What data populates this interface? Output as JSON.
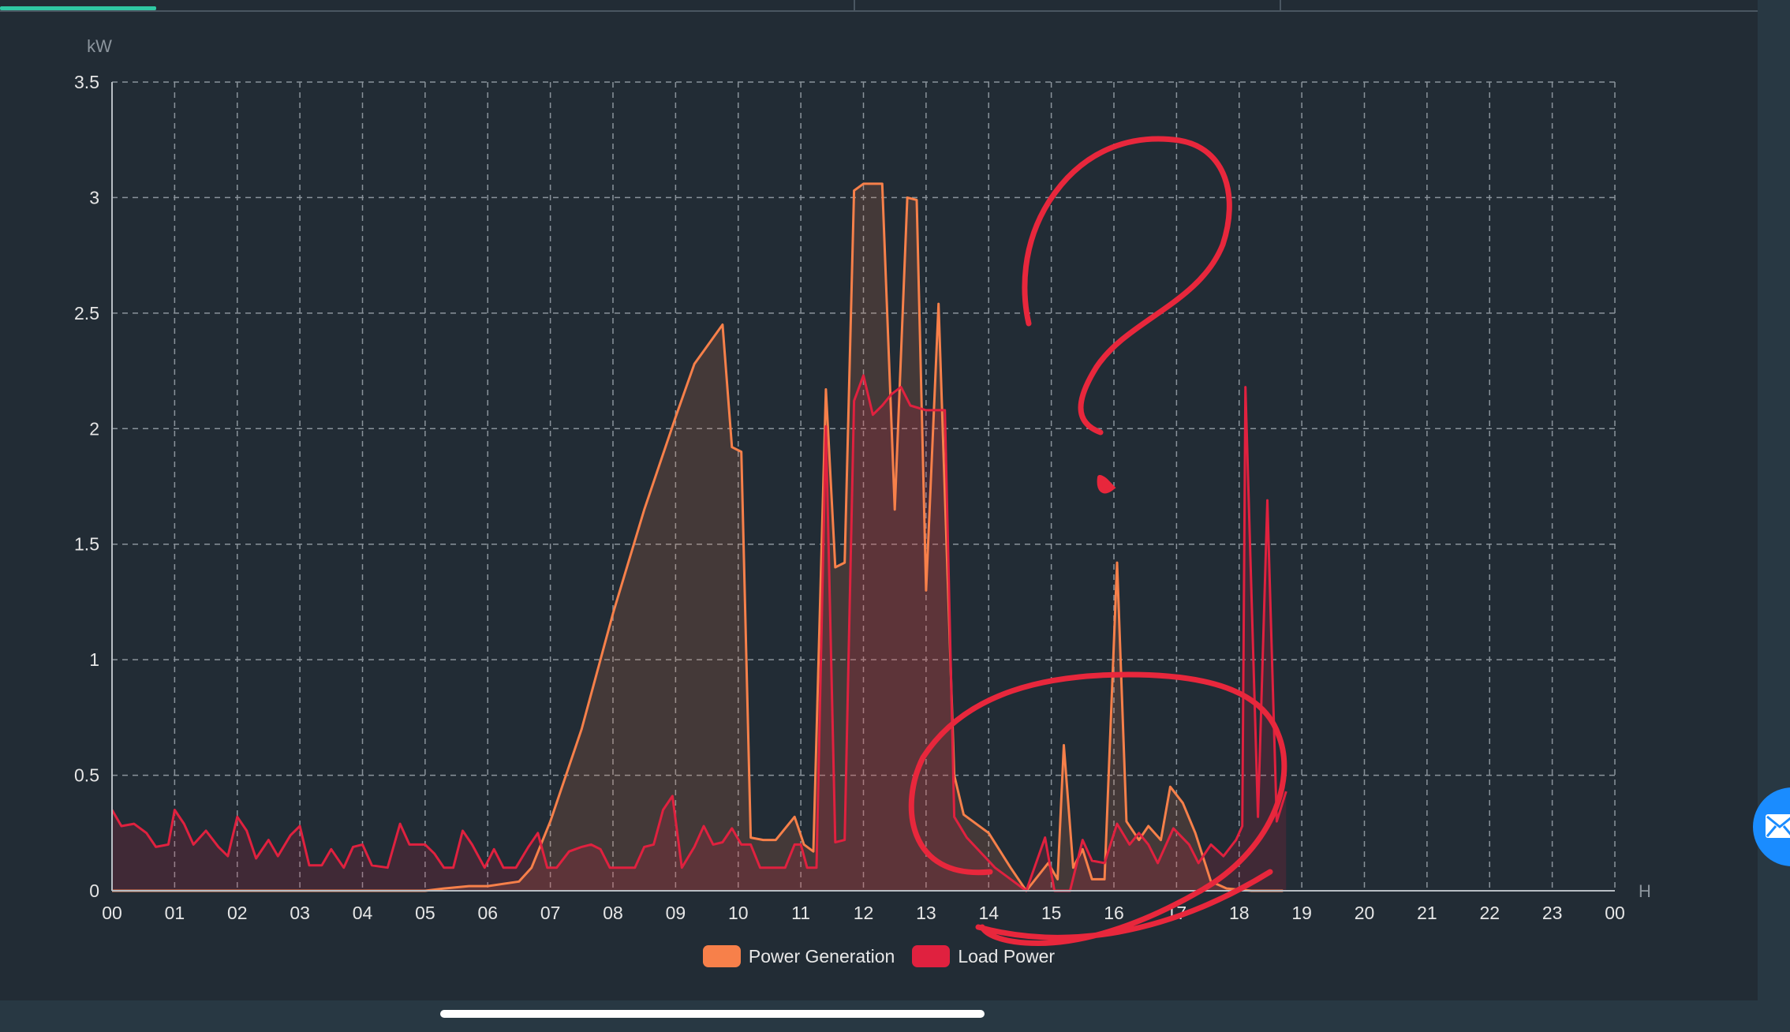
{
  "chart_data": {
    "type": "line",
    "unit_label": "kW",
    "x_unit_label": "H",
    "ylim": [
      0,
      3.5
    ],
    "y_ticks": [
      "0",
      "0.5",
      "1",
      "1.5",
      "2",
      "2.5",
      "3",
      "3.5"
    ],
    "x_ticks": [
      "00",
      "01",
      "02",
      "03",
      "04",
      "05",
      "06",
      "07",
      "08",
      "09",
      "10",
      "11",
      "12",
      "13",
      "14",
      "15",
      "16",
      "17",
      "18",
      "19",
      "20",
      "21",
      "22",
      "23",
      "00"
    ],
    "grid": true,
    "legend_position": "bottom-center",
    "series": [
      {
        "name": "Power Generation",
        "color": "#f7804a",
        "points": [
          [
            0,
            0
          ],
          [
            1,
            0
          ],
          [
            2,
            0
          ],
          [
            3,
            0
          ],
          [
            4,
            0
          ],
          [
            5,
            0
          ],
          [
            5.3,
            0.01
          ],
          [
            5.7,
            0.02
          ],
          [
            6,
            0.02
          ],
          [
            6.5,
            0.04
          ],
          [
            6.7,
            0.1
          ],
          [
            7,
            0.3
          ],
          [
            7.5,
            0.7
          ],
          [
            8,
            1.2
          ],
          [
            8.5,
            1.65
          ],
          [
            9,
            2.05
          ],
          [
            9.3,
            2.28
          ],
          [
            9.75,
            2.45
          ],
          [
            9.9,
            1.92
          ],
          [
            10.05,
            1.9
          ],
          [
            10.2,
            0.23
          ],
          [
            10.4,
            0.22
          ],
          [
            10.6,
            0.22
          ],
          [
            10.9,
            0.32
          ],
          [
            11.05,
            0.2
          ],
          [
            11.2,
            0.17
          ],
          [
            11.4,
            2.17
          ],
          [
            11.55,
            1.4
          ],
          [
            11.7,
            1.42
          ],
          [
            11.85,
            3.03
          ],
          [
            12,
            3.06
          ],
          [
            12.3,
            3.06
          ],
          [
            12.5,
            1.65
          ],
          [
            12.7,
            3.0
          ],
          [
            12.85,
            2.99
          ],
          [
            13,
            1.3
          ],
          [
            13.2,
            2.54
          ],
          [
            13.45,
            0.5
          ],
          [
            13.6,
            0.33
          ],
          [
            14,
            0.25
          ],
          [
            14.35,
            0.1
          ],
          [
            14.6,
            0.0
          ],
          [
            14.95,
            0.12
          ],
          [
            15.1,
            0.05
          ],
          [
            15.2,
            0.63
          ],
          [
            15.35,
            0.1
          ],
          [
            15.5,
            0.18
          ],
          [
            15.65,
            0.05
          ],
          [
            15.85,
            0.05
          ],
          [
            16.05,
            1.42
          ],
          [
            16.2,
            0.3
          ],
          [
            16.4,
            0.22
          ],
          [
            16.55,
            0.28
          ],
          [
            16.75,
            0.22
          ],
          [
            16.9,
            0.45
          ],
          [
            17.1,
            0.38
          ],
          [
            17.3,
            0.25
          ],
          [
            17.55,
            0.04
          ],
          [
            17.8,
            0.01
          ],
          [
            18.2,
            0.0
          ],
          [
            18.7,
            0.0
          ]
        ]
      },
      {
        "name": "Load Power",
        "color": "#e0213f",
        "points": [
          [
            0,
            0.35
          ],
          [
            0.15,
            0.28
          ],
          [
            0.35,
            0.29
          ],
          [
            0.55,
            0.25
          ],
          [
            0.7,
            0.19
          ],
          [
            0.9,
            0.2
          ],
          [
            1,
            0.35
          ],
          [
            1.15,
            0.29
          ],
          [
            1.3,
            0.2
          ],
          [
            1.5,
            0.26
          ],
          [
            1.7,
            0.19
          ],
          [
            1.85,
            0.15
          ],
          [
            2,
            0.32
          ],
          [
            2.15,
            0.26
          ],
          [
            2.3,
            0.14
          ],
          [
            2.5,
            0.22
          ],
          [
            2.65,
            0.15
          ],
          [
            2.85,
            0.24
          ],
          [
            3,
            0.28
          ],
          [
            3.15,
            0.11
          ],
          [
            3.35,
            0.11
          ],
          [
            3.5,
            0.18
          ],
          [
            3.7,
            0.1
          ],
          [
            3.85,
            0.19
          ],
          [
            4,
            0.2
          ],
          [
            4.15,
            0.11
          ],
          [
            4.4,
            0.1
          ],
          [
            4.6,
            0.29
          ],
          [
            4.75,
            0.2
          ],
          [
            5,
            0.2
          ],
          [
            5.15,
            0.16
          ],
          [
            5.3,
            0.1
          ],
          [
            5.45,
            0.1
          ],
          [
            5.6,
            0.26
          ],
          [
            5.75,
            0.2
          ],
          [
            5.95,
            0.1
          ],
          [
            6.1,
            0.18
          ],
          [
            6.25,
            0.1
          ],
          [
            6.45,
            0.1
          ],
          [
            6.65,
            0.19
          ],
          [
            6.8,
            0.25
          ],
          [
            6.95,
            0.1
          ],
          [
            7.1,
            0.1
          ],
          [
            7.3,
            0.17
          ],
          [
            7.5,
            0.19
          ],
          [
            7.65,
            0.2
          ],
          [
            7.8,
            0.18
          ],
          [
            7.95,
            0.1
          ],
          [
            8.15,
            0.1
          ],
          [
            8.35,
            0.1
          ],
          [
            8.5,
            0.19
          ],
          [
            8.65,
            0.2
          ],
          [
            8.8,
            0.35
          ],
          [
            8.95,
            0.41
          ],
          [
            9.1,
            0.1
          ],
          [
            9.3,
            0.19
          ],
          [
            9.45,
            0.28
          ],
          [
            9.6,
            0.2
          ],
          [
            9.75,
            0.21
          ],
          [
            9.9,
            0.27
          ],
          [
            10.05,
            0.2
          ],
          [
            10.2,
            0.2
          ],
          [
            10.35,
            0.1
          ],
          [
            10.55,
            0.1
          ],
          [
            10.75,
            0.1
          ],
          [
            10.9,
            0.2
          ],
          [
            11,
            0.2
          ],
          [
            11.1,
            0.1
          ],
          [
            11.25,
            0.1
          ],
          [
            11.4,
            2.01
          ],
          [
            11.55,
            0.21
          ],
          [
            11.7,
            0.22
          ],
          [
            11.85,
            2.12
          ],
          [
            12,
            2.23
          ],
          [
            12.15,
            2.06
          ],
          [
            12.3,
            2.1
          ],
          [
            12.45,
            2.15
          ],
          [
            12.6,
            2.18
          ],
          [
            12.75,
            2.1
          ],
          [
            13,
            2.08
          ],
          [
            13.15,
            2.08
          ],
          [
            13.3,
            2.08
          ],
          [
            13.45,
            0.32
          ],
          [
            13.65,
            0.23
          ],
          [
            14.1,
            0.1
          ],
          [
            14.6,
            0.0
          ],
          [
            14.9,
            0.23
          ],
          [
            15.05,
            0.0
          ],
          [
            15.3,
            0.0
          ],
          [
            15.5,
            0.22
          ],
          [
            15.65,
            0.13
          ],
          [
            15.85,
            0.12
          ],
          [
            16.05,
            0.29
          ],
          [
            16.25,
            0.2
          ],
          [
            16.4,
            0.25
          ],
          [
            16.55,
            0.2
          ],
          [
            16.7,
            0.12
          ],
          [
            16.95,
            0.27
          ],
          [
            17.2,
            0.2
          ],
          [
            17.35,
            0.12
          ],
          [
            17.55,
            0.2
          ],
          [
            17.75,
            0.15
          ],
          [
            17.95,
            0.22
          ],
          [
            18.05,
            0.28
          ],
          [
            18.1,
            2.18
          ],
          [
            18.3,
            0.32
          ],
          [
            18.45,
            1.69
          ],
          [
            18.6,
            0.3
          ],
          [
            18.75,
            0.43
          ]
        ]
      }
    ]
  },
  "legend": {
    "generation_label": "Power Generation",
    "load_label": "Load Power"
  },
  "colors": {
    "background": "#222c35",
    "grid": "#8a939b",
    "annotation": "#e8273c",
    "float_button": "#1a8cff"
  }
}
